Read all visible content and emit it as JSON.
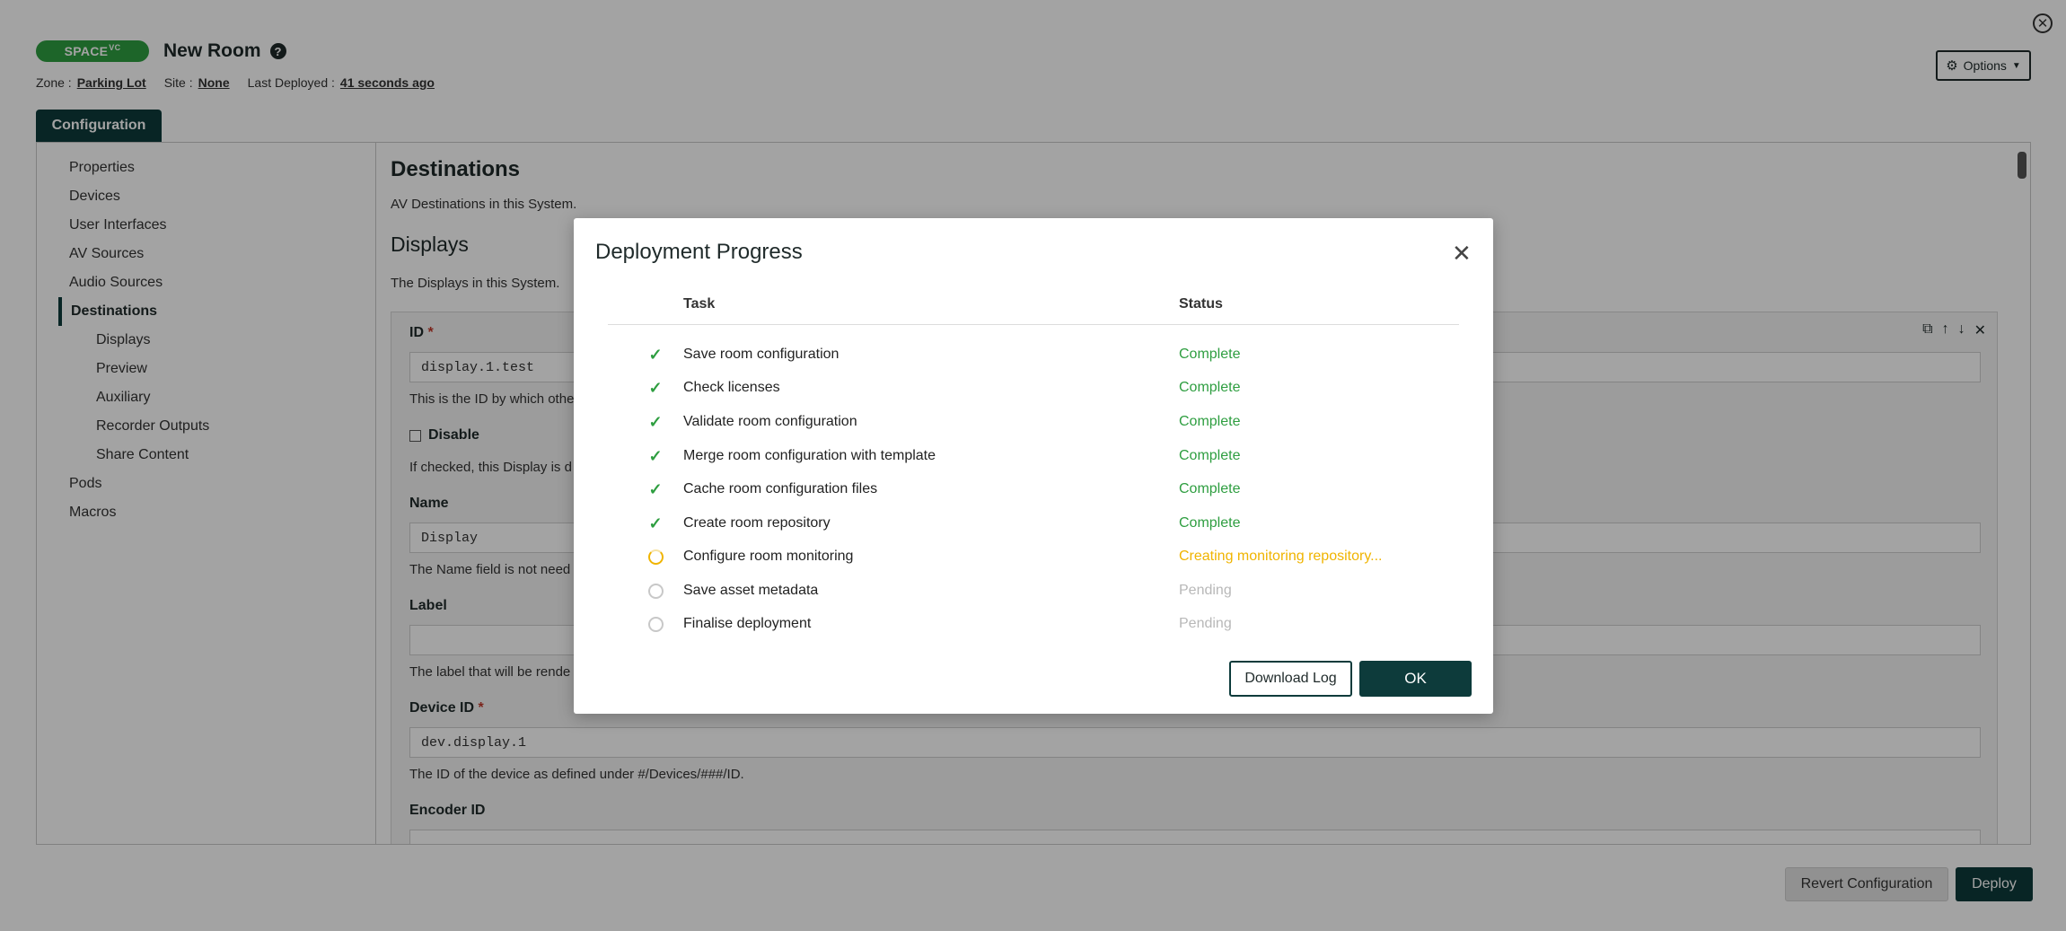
{
  "header": {
    "brand": "SPACE",
    "brand_sup": "VC",
    "room_title": "New Room",
    "zone_label": "Zone :",
    "zone_value": "Parking Lot",
    "site_label": "Site :",
    "site_value": "None",
    "deployed_label": "Last Deployed :",
    "deployed_value": "41 seconds ago",
    "options_label": "Options"
  },
  "tabs": [
    {
      "label": "Configuration"
    }
  ],
  "sidebar": {
    "items": [
      {
        "label": "Properties"
      },
      {
        "label": "Devices"
      },
      {
        "label": "User Interfaces"
      },
      {
        "label": "AV Sources"
      },
      {
        "label": "Audio Sources"
      },
      {
        "label": "Destinations"
      },
      {
        "label": "Displays"
      },
      {
        "label": "Preview"
      },
      {
        "label": "Auxiliary"
      },
      {
        "label": "Recorder Outputs"
      },
      {
        "label": "Share Content"
      },
      {
        "label": "Pods"
      },
      {
        "label": "Macros"
      }
    ]
  },
  "main": {
    "destinations_title": "Destinations",
    "destinations_desc": "AV Destinations in this System.",
    "displays_title": "Displays",
    "displays_desc": "The Displays in this System.",
    "id_label": "ID",
    "id_value": "display.1.test",
    "id_help": "This is the ID by which othe",
    "disable_label": "Disable",
    "disable_help": "If checked, this Display is d",
    "name_label": "Name",
    "name_value": "Display",
    "name_help": "The Name field is not need",
    "label_label": "Label",
    "label_value": "",
    "label_help": "The label that will be rende",
    "device_id_label": "Device ID",
    "device_id_value": "dev.display.1",
    "device_id_help": "The ID of the device as defined under #/Devices/###/ID.",
    "encoder_id_label": "Encoder ID",
    "required_mark": "*"
  },
  "footer": {
    "revert_label": "Revert Configuration",
    "deploy_label": "Deploy"
  },
  "modal": {
    "title": "Deployment Progress",
    "col_task": "Task",
    "col_status": "Status",
    "tasks": [
      {
        "name": "Save room configuration",
        "status": "Complete"
      },
      {
        "name": "Check licenses",
        "status": "Complete"
      },
      {
        "name": "Validate room configuration",
        "status": "Complete"
      },
      {
        "name": "Merge room configuration with template",
        "status": "Complete"
      },
      {
        "name": "Cache room configuration files",
        "status": "Complete"
      },
      {
        "name": "Create room repository",
        "status": "Complete"
      },
      {
        "name": "Configure room monitoring",
        "status": "Creating monitoring repository..."
      },
      {
        "name": "Save asset metadata",
        "status": "Pending"
      },
      {
        "name": "Finalise deployment",
        "status": "Pending"
      }
    ],
    "download_label": "Download Log",
    "ok_label": "OK"
  },
  "colors": {
    "brand_green": "#2e9e40",
    "dark_teal": "#0d3b3b",
    "in_progress": "#f0b400",
    "pending": "#b8b8b8"
  }
}
